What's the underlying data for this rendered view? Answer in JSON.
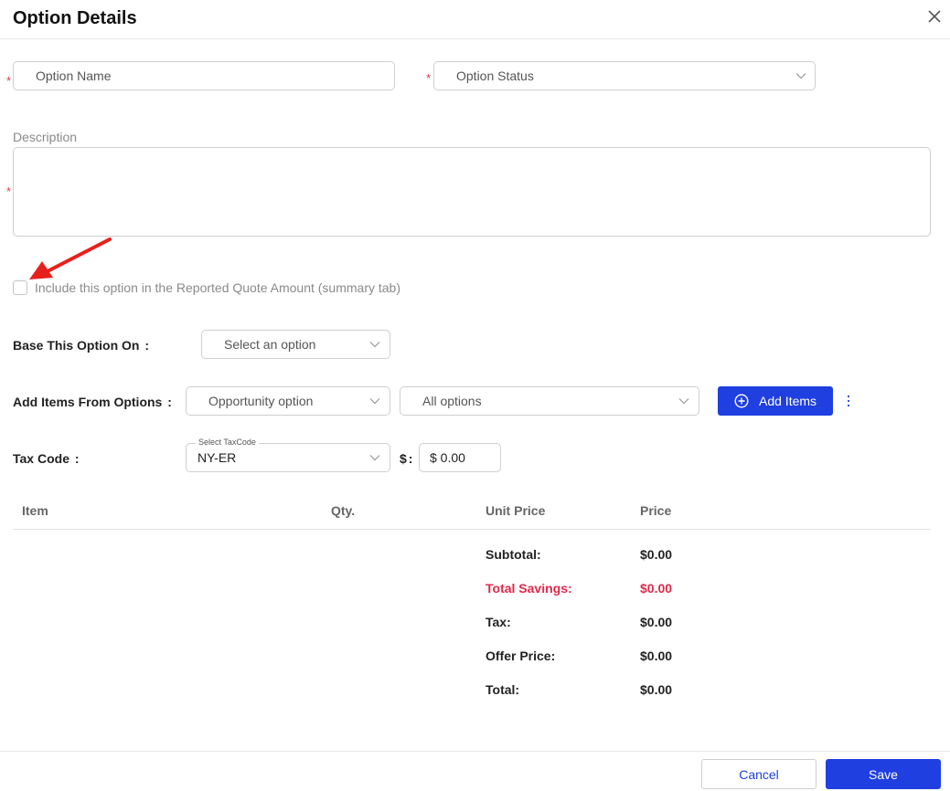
{
  "dialog": {
    "title": "Option Details"
  },
  "form": {
    "required_mark": "*",
    "option_name": {
      "placeholder": "Option Name",
      "value": ""
    },
    "option_status": {
      "placeholder": "Option Status"
    },
    "description": {
      "label": "Description",
      "value": ""
    },
    "include_checkbox": {
      "label": "Include this option in the Reported Quote Amount (summary tab)",
      "checked": false
    },
    "base_option": {
      "label": "Base This Option On",
      "colon": ":",
      "placeholder": "Select an option"
    },
    "add_items": {
      "label": "Add Items From Options",
      "colon": ":",
      "source_value": "Opportunity option",
      "filter_value": "All options",
      "button_label": "Add Items"
    },
    "tax": {
      "label": "Tax Code",
      "colon": ":",
      "floating_label": "Select TaxCode",
      "code_value": "NY-ER",
      "dollar_label": "$",
      "dollar_colon": ":",
      "amount_value": "$ 0.00"
    }
  },
  "table": {
    "headers": [
      "Item",
      "Qty.",
      "Unit Price",
      "Price"
    ],
    "summary": [
      {
        "label": "Subtotal:",
        "value": "$0.00"
      },
      {
        "label": "Total Savings:",
        "value": "$0.00"
      },
      {
        "label": "Tax:",
        "value": "$0.00"
      },
      {
        "label": "Offer Price:",
        "value": "$0.00"
      },
      {
        "label": "Total:",
        "value": "$0.00"
      }
    ]
  },
  "footer": {
    "cancel_label": "Cancel",
    "save_label": "Save"
  },
  "colors": {
    "primary": "#1f3fe0",
    "required": "#e23b3b",
    "savings": "#e0284a",
    "annotation_arrow": "#e8201c"
  }
}
